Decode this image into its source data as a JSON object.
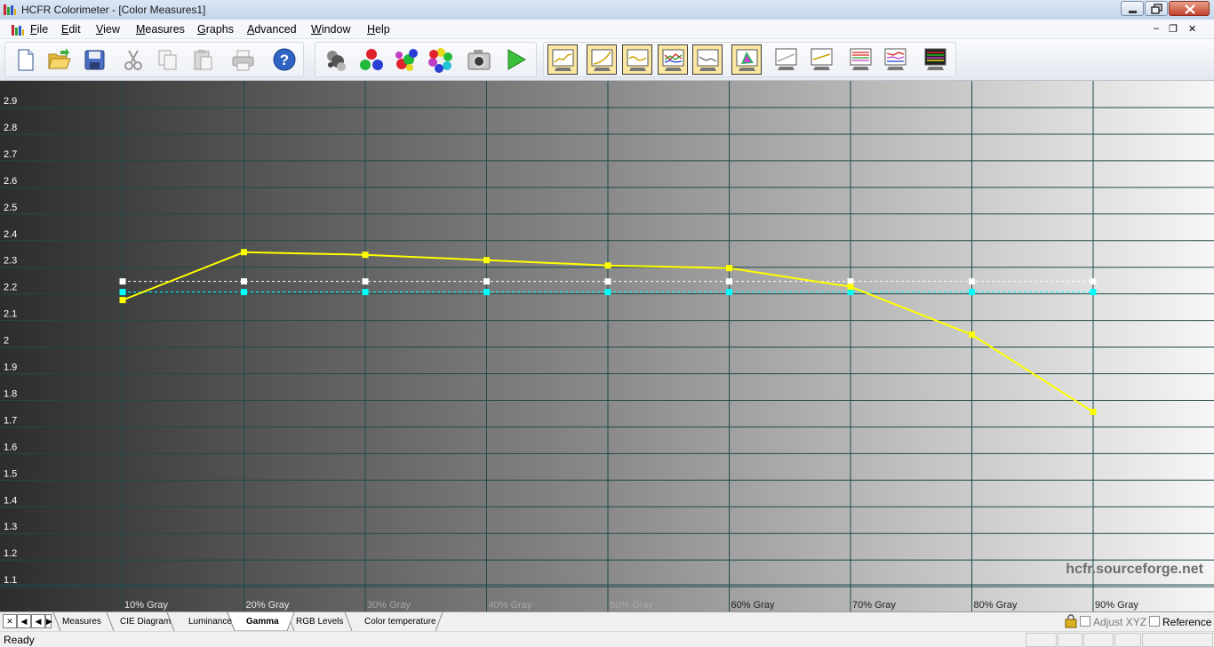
{
  "window": {
    "title": "HCFR Colorimeter - [Color Measures1]",
    "icons": [
      "app-icon",
      "minimize-icon",
      "maximize-icon",
      "close-icon"
    ]
  },
  "menu": {
    "items": [
      {
        "label": "File",
        "acc": "F",
        "rest": "ile"
      },
      {
        "label": "Edit",
        "acc": "E",
        "rest": "dit"
      },
      {
        "label": "View",
        "acc": "V",
        "rest": "iew"
      },
      {
        "label": "Measures",
        "acc": "M",
        "rest": "easures"
      },
      {
        "label": "Graphs",
        "acc": "G",
        "rest": "raphs"
      },
      {
        "label": "Advanced",
        "acc": "A",
        "rest": "dvanced"
      },
      {
        "label": "Window",
        "acc": "W",
        "rest": "indow"
      },
      {
        "label": "Help",
        "acc": "H",
        "rest": "elp"
      }
    ],
    "mdi_min": "–",
    "mdi_restore": "❐",
    "mdi_close": "✕"
  },
  "toolbar": {
    "buttons": [
      "new-file",
      "open-folder",
      "save",
      "cut",
      "copy",
      "paste",
      "print",
      "help",
      "sensor",
      "rgb-patterns",
      "multi-color",
      "color-wheel",
      "camera",
      "play",
      "graph-gray-scale",
      "graph-gamma",
      "graph-luminance",
      "graph-rgb",
      "graph-color-temp",
      "graph-cie",
      "graph-a",
      "graph-b",
      "graph-c",
      "graph-d",
      "graph-e"
    ]
  },
  "chart_data": {
    "type": "line",
    "categories": [
      "10% Gray",
      "20% Gray",
      "30% Gray",
      "40% Gray",
      "50% Gray",
      "60% Gray",
      "70% Gray",
      "80% Gray",
      "90% Gray"
    ],
    "series": [
      {
        "values": [
          2.15,
          2.33,
          2.32,
          2.3,
          2.28,
          2.27,
          2.2,
          2.02,
          1.73
        ]
      },
      {
        "values": [
          2.22,
          2.22,
          2.22,
          2.22,
          2.22,
          2.22,
          2.22,
          2.22,
          2.22
        ]
      },
      {
        "values": [
          2.18,
          2.18,
          2.18,
          2.18,
          2.18,
          2.18,
          2.18,
          2.18,
          2.18
        ]
      }
    ],
    "yticks": [
      "2.9",
      "2.8",
      "2.7",
      "2.6",
      "2.5",
      "2.4",
      "2.3",
      "2.2",
      "2.1",
      "2",
      "1.9",
      "1.8",
      "1.7",
      "1.6",
      "1.5",
      "1.4",
      "1.3",
      "1.2",
      "1.1"
    ],
    "ylim": [
      1.0,
      2.95
    ],
    "grid": true,
    "colors": {
      "measured": "#ffff00",
      "reference": "#ffffff",
      "target": "#00ffff",
      "grid": "#1f4a4a"
    },
    "watermark": "hcfr.sourceforge.net"
  },
  "tabs": {
    "items": [
      "Measures",
      "CIE Diagram",
      "Luminance",
      "Gamma",
      "RGB Levels",
      "Color temperature"
    ],
    "active": "Gamma",
    "nav": [
      "✕",
      "◀",
      "◀",
      "▶"
    ]
  },
  "options": {
    "adjust_xyz": "Adjust XYZ",
    "reference": "Reference"
  },
  "status": {
    "text": "Ready"
  }
}
